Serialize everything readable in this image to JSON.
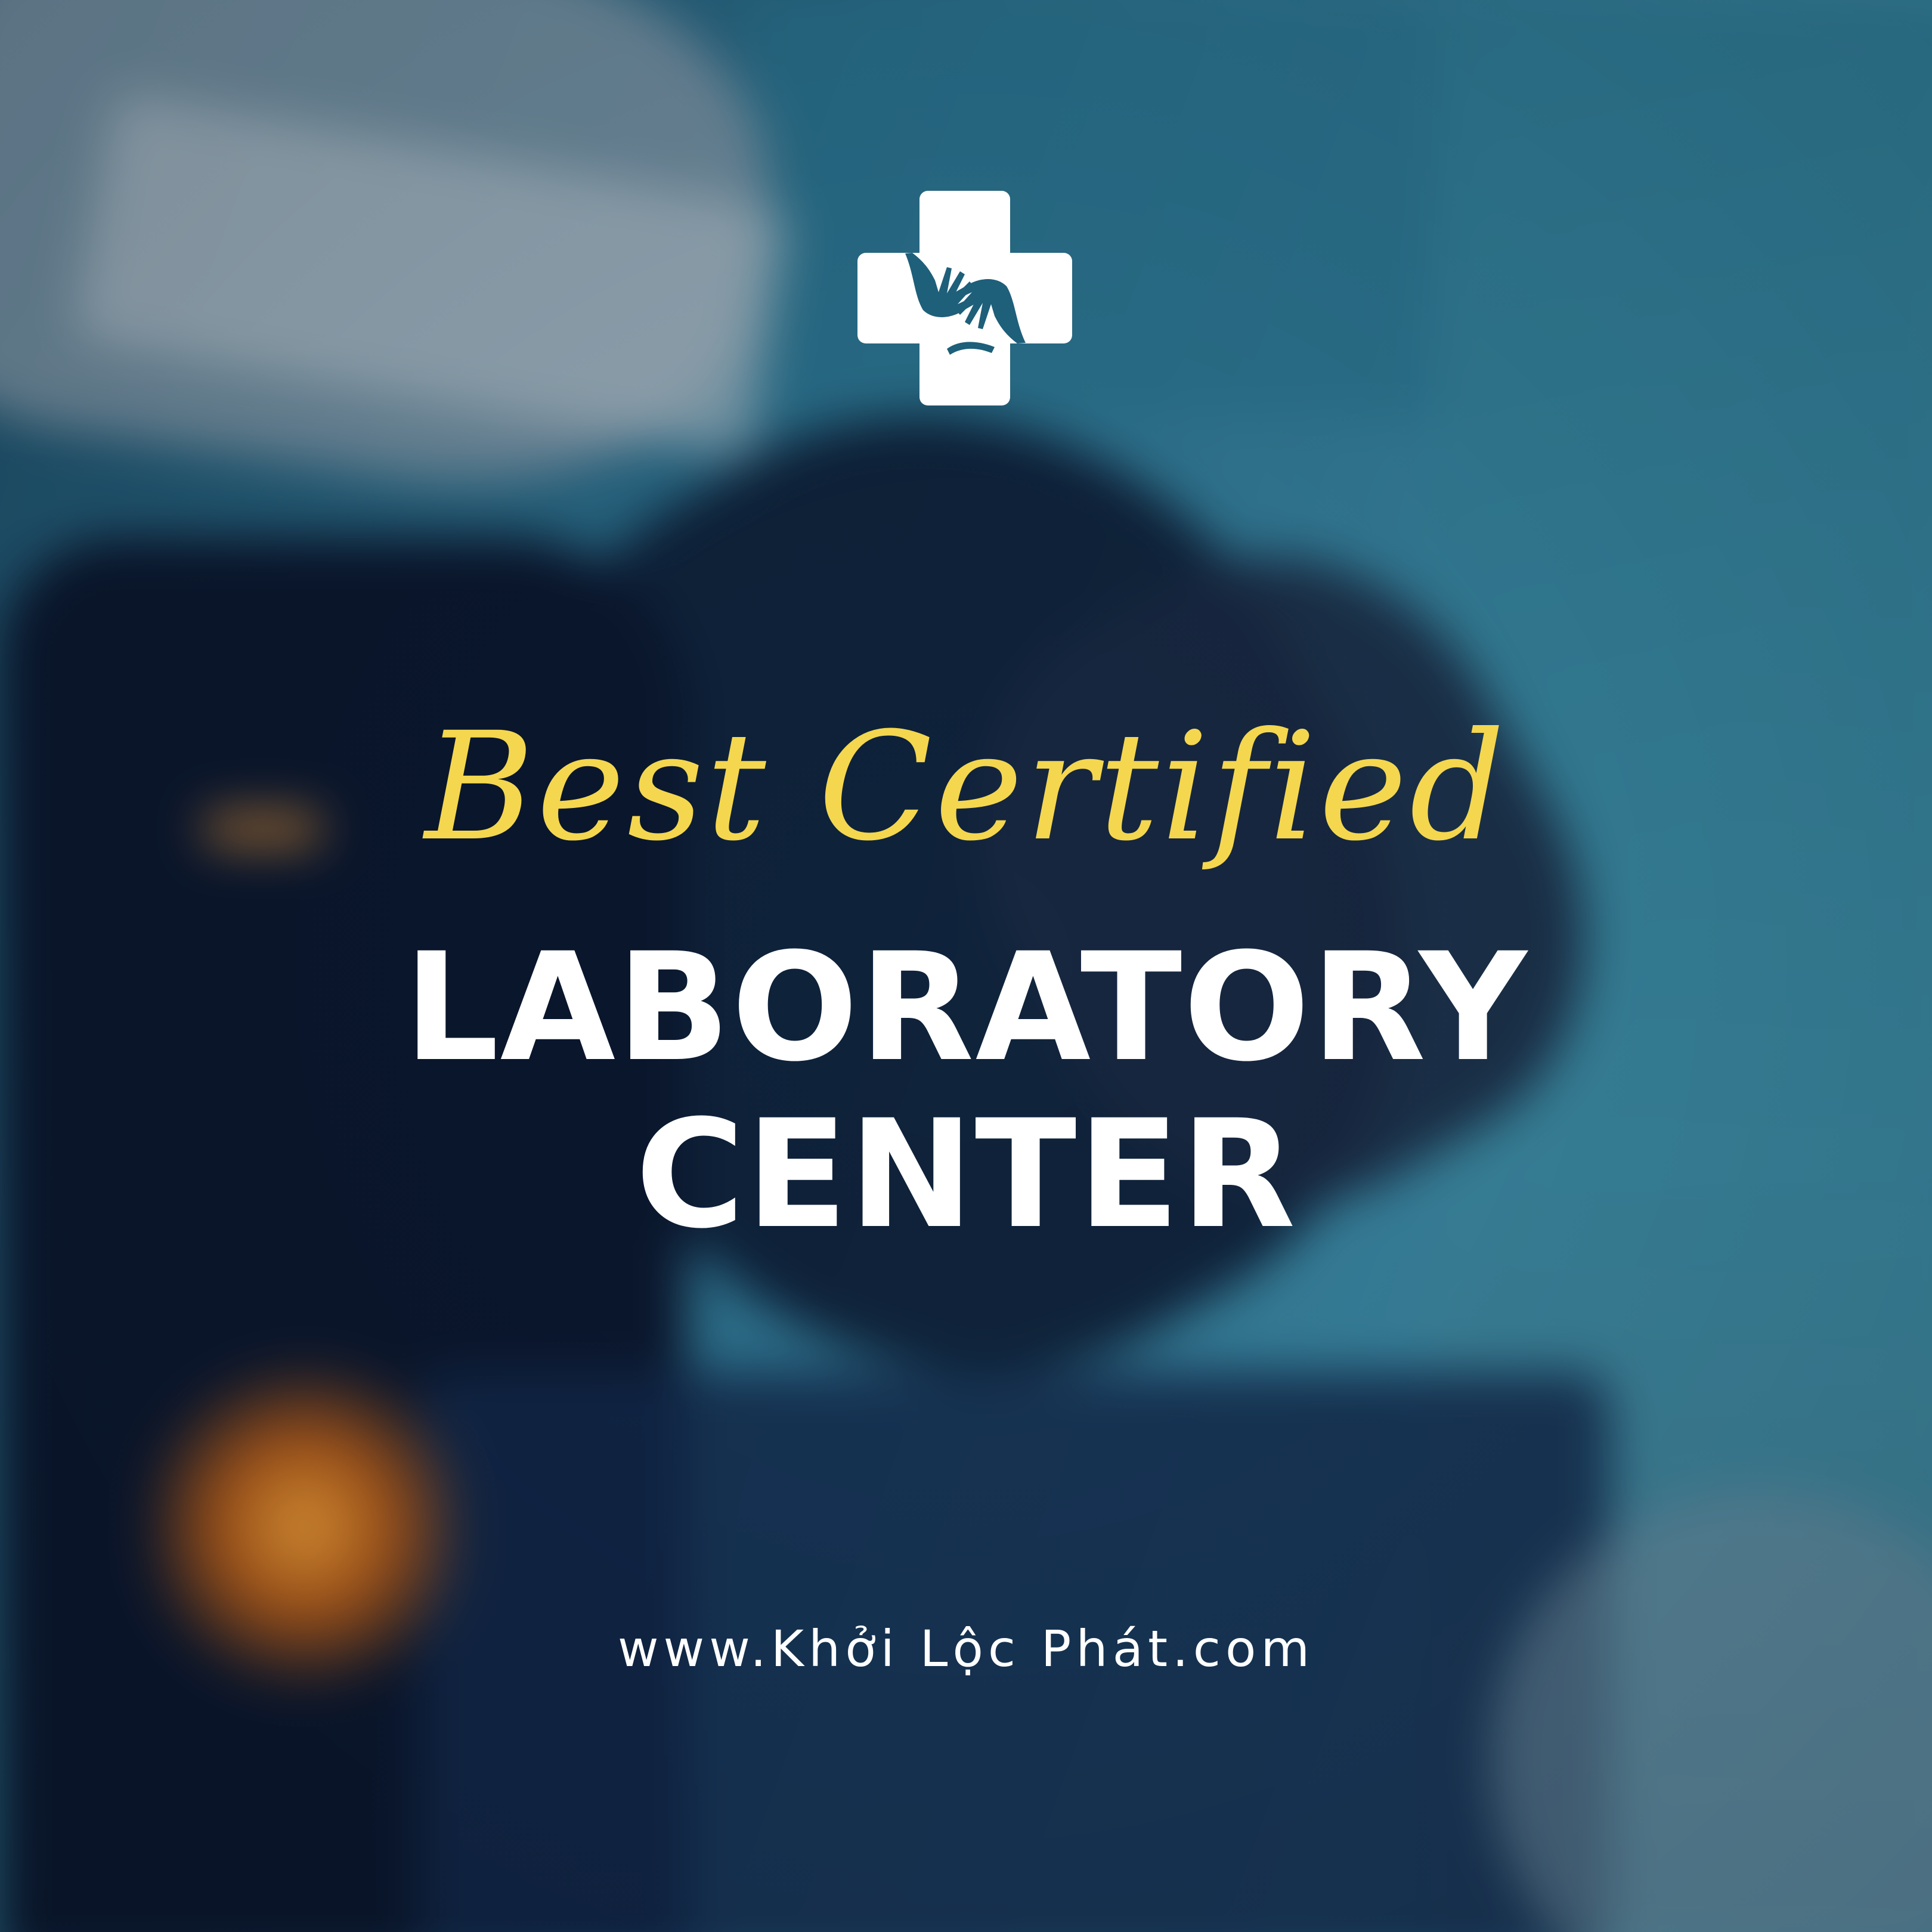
{
  "logo": {
    "icon": "medical-cross-hands-icon",
    "color": "#ffffff"
  },
  "tagline": "Best Certified",
  "headline": {
    "line1": "LABORATORY",
    "line2": "CENTER"
  },
  "website": "www.Khởi Lộc Phát.com",
  "colors": {
    "tagline": "#f4d74f",
    "headline": "#ffffff",
    "background": "#2f7a93"
  }
}
